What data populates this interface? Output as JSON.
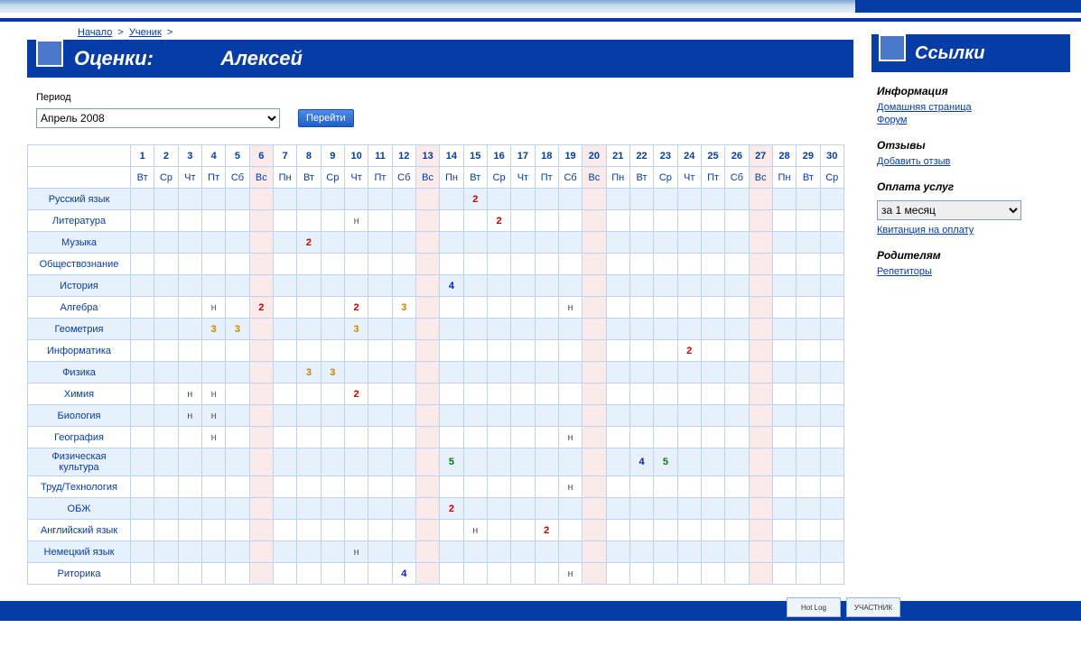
{
  "breadcrumbs": {
    "home": "Начало",
    "sep": ">",
    "student": "Ученик"
  },
  "title": {
    "prefix": "Оценки:",
    "name": "Алексей"
  },
  "period": {
    "label": "Период",
    "selected": "Апрель 2008",
    "go": "Перейти"
  },
  "calendar": {
    "weekend_indices": [
      5,
      12,
      19,
      26
    ],
    "days_num": [
      "1",
      "2",
      "3",
      "4",
      "5",
      "6",
      "7",
      "8",
      "9",
      "10",
      "11",
      "12",
      "13",
      "14",
      "15",
      "16",
      "17",
      "18",
      "19",
      "20",
      "21",
      "22",
      "23",
      "24",
      "25",
      "26",
      "27",
      "28",
      "29",
      "30"
    ],
    "days_dow": [
      "Вт",
      "Ср",
      "Чт",
      "Пт",
      "Сб",
      "Вс",
      "Пн",
      "Вт",
      "Ср",
      "Чт",
      "Пт",
      "Сб",
      "Вс",
      "Пн",
      "Вт",
      "Ср",
      "Чт",
      "Пт",
      "Сб",
      "Вс",
      "Пн",
      "Вт",
      "Ср",
      "Чт",
      "Пт",
      "Сб",
      "Вс",
      "Пн",
      "Вт",
      "Ср"
    ]
  },
  "subjects": [
    {
      "name": "Русский язык",
      "marks": {
        "14": "2"
      }
    },
    {
      "name": "Литература",
      "marks": {
        "9": "н",
        "15": "2"
      }
    },
    {
      "name": "Музыка",
      "marks": {
        "7": "2"
      }
    },
    {
      "name": "Обществознание",
      "marks": {}
    },
    {
      "name": "История",
      "marks": {
        "13": "4"
      }
    },
    {
      "name": "Алгебра",
      "marks": {
        "3": "н",
        "5": "2",
        "9": "2",
        "11": "3",
        "18": "н"
      }
    },
    {
      "name": "Геометрия",
      "marks": {
        "3": "3",
        "4": "3",
        "9": "3"
      }
    },
    {
      "name": "Информатика",
      "marks": {
        "23": "2"
      }
    },
    {
      "name": "Физика",
      "marks": {
        "7": "3",
        "8": "3"
      }
    },
    {
      "name": "Химия",
      "marks": {
        "2": "н",
        "3": "н",
        "9": "2"
      }
    },
    {
      "name": "Биология",
      "marks": {
        "2": "н",
        "3": "н"
      }
    },
    {
      "name": "География",
      "marks": {
        "3": "н",
        "18": "н"
      }
    },
    {
      "name": "Физическая культура",
      "marks": {
        "13": "5",
        "21": "4",
        "22": "5"
      }
    },
    {
      "name": "Труд/Технология",
      "marks": {
        "18": "н"
      }
    },
    {
      "name": "ОБЖ",
      "marks": {
        "13": "2"
      }
    },
    {
      "name": "Английский язык",
      "marks": {
        "14": "н",
        "17": "2"
      }
    },
    {
      "name": "Немецкий язык",
      "marks": {
        "9": "н"
      }
    },
    {
      "name": "Риторика",
      "marks": {
        "11": "4",
        "18": "н"
      }
    }
  ],
  "sidebar": {
    "title": "Ссылки",
    "sections": [
      {
        "heading": "Информация",
        "links": [
          "Домашняя страница",
          "Форум"
        ]
      },
      {
        "heading": "Отзывы",
        "links": [
          "Добавить отзыв"
        ]
      },
      {
        "heading": "Оплата услуг",
        "select": "за 1 месяц",
        "links": [
          "Квитанция на оплату"
        ]
      },
      {
        "heading": "Родителям",
        "links": [
          "Репетиторы"
        ]
      }
    ]
  },
  "footer": {
    "badge1": "Hot Log",
    "badge2": "УЧАСТНИК"
  }
}
